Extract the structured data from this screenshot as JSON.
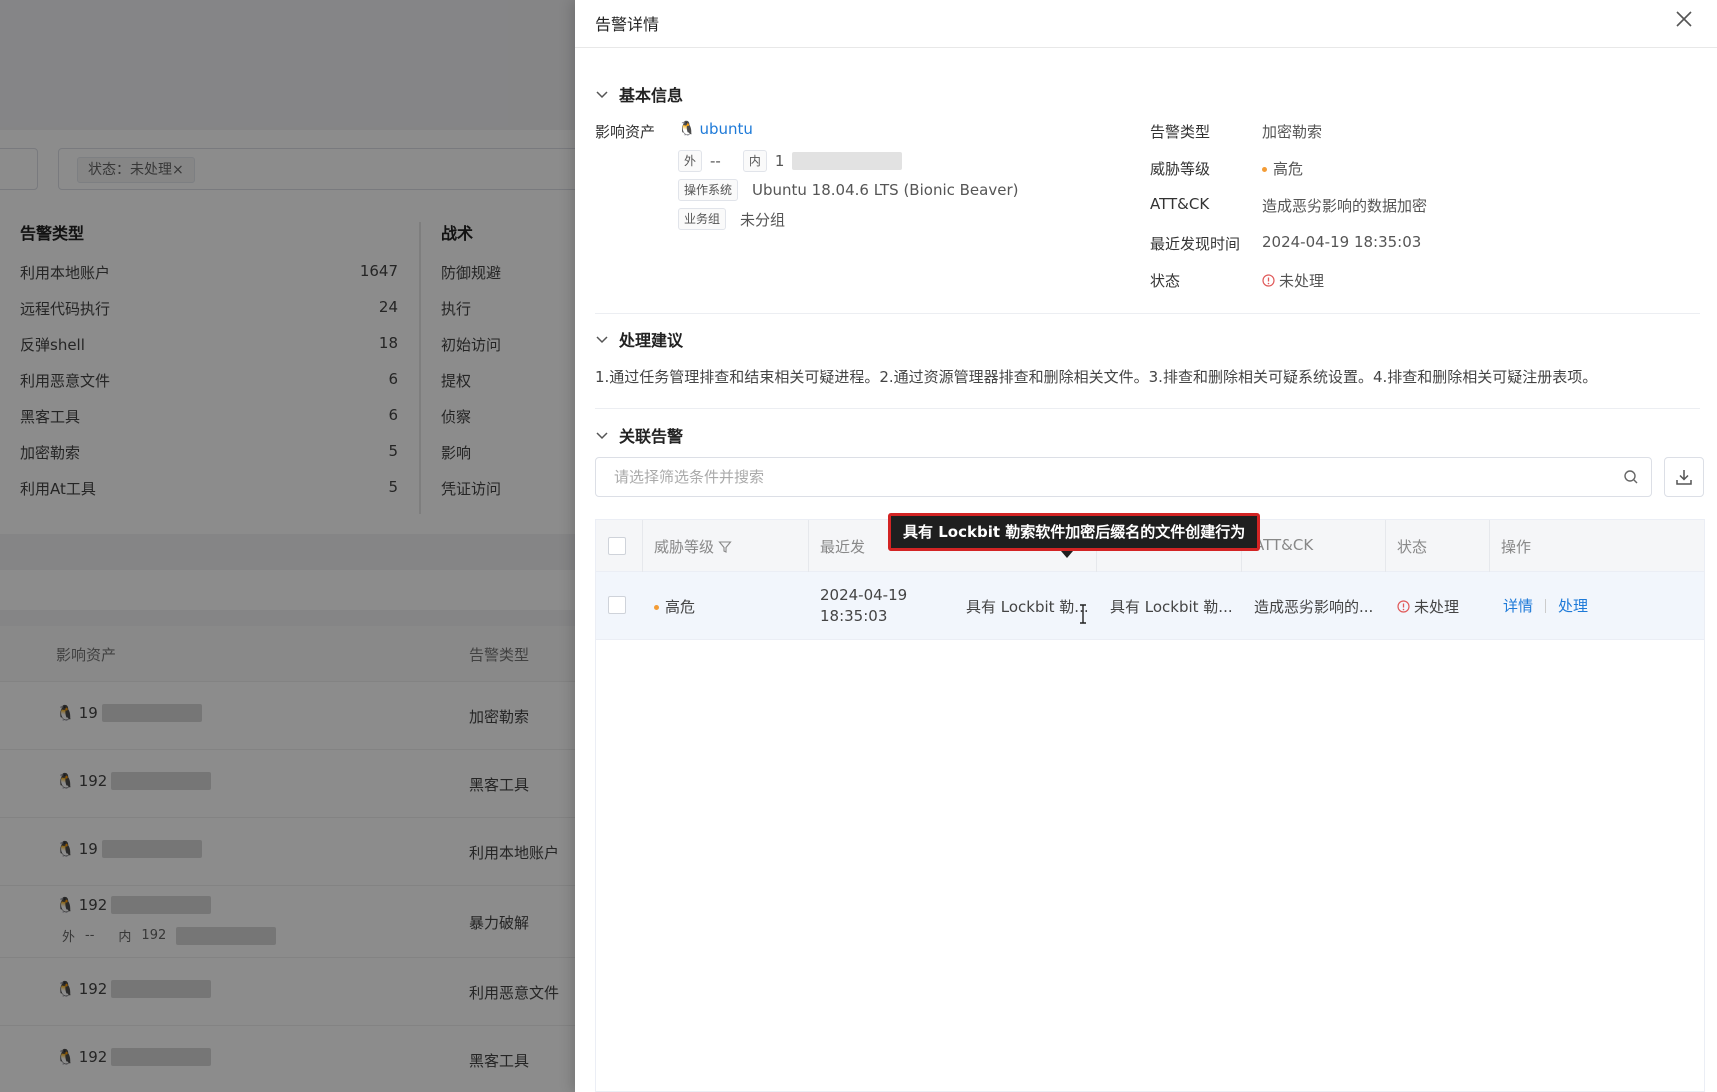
{
  "background": {
    "filter_chip": "状态：未处理×",
    "stats_title": "告警类型",
    "tactics_title": "战术",
    "stats": [
      {
        "name": "利用本地账户",
        "count": "1647"
      },
      {
        "name": "远程代码执行",
        "count": "24"
      },
      {
        "name": "反弹shell",
        "count": "18"
      },
      {
        "name": "利用恶意文件",
        "count": "6"
      },
      {
        "name": "黑客工具",
        "count": "6"
      },
      {
        "name": "加密勒索",
        "count": "5"
      },
      {
        "name": "利用At工具",
        "count": "5"
      }
    ],
    "tactics": [
      "防御规避",
      "执行",
      "初始访问",
      "提权",
      "侦察",
      "影响",
      "凭证访问"
    ],
    "table_headers": {
      "asset": "影响资产",
      "type": "告警类型"
    },
    "rows": [
      {
        "ip": "19",
        "type": "加密勒索"
      },
      {
        "ip": "192",
        "type": "黑客工具"
      },
      {
        "ip": "19",
        "type": "利用本地账户"
      },
      {
        "ip": "192",
        "type": "暴力破解",
        "ext_label": "外",
        "ext_value": "--",
        "int_label": "内",
        "int_value": "192"
      },
      {
        "ip": "192",
        "type": "利用恶意文件"
      },
      {
        "ip": "192",
        "type": "黑客工具"
      }
    ]
  },
  "drawer": {
    "title": "告警详情",
    "basic": {
      "section_title": "基本信息",
      "asset_label": "影响资产",
      "asset_name": "ubuntu",
      "ext_tag": "外",
      "ext_value": "--",
      "int_tag": "内",
      "int_value": "1",
      "os_tag": "操作系统",
      "os_value": "Ubuntu 18.04.6 LTS (Bionic Beaver)",
      "group_tag": "业务组",
      "group_value": "未分组",
      "alert_type_label": "告警类型",
      "alert_type_value": "加密勒索",
      "threat_label": "威胁等级",
      "threat_value": "高危",
      "attck_label": "ATT&CK",
      "attck_value": "造成恶劣影响的数据加密",
      "recent_label": "最近发现时间",
      "recent_value": "2024-04-19 18:35:03",
      "status_label": "状态",
      "status_value": "未处理"
    },
    "advice": {
      "section_title": "处理建议",
      "text": "1.通过任务管理排查和结束相关可疑进程。2.通过资源管理器排查和删除相关文件。3.排查和删除相关可疑系统设置。4.排查和删除相关可疑注册表项。"
    },
    "related": {
      "section_title": "关联告警",
      "search_placeholder": "请选择筛选条件并搜索",
      "headers": {
        "threat": "威胁等级",
        "recent": "最近发",
        "attck": "ATT&CK",
        "status": "状态",
        "action": "操作"
      },
      "rows": [
        {
          "threat": "高危",
          "date": "2024-04-19",
          "time": "18:35:03",
          "col3": "具有 Lockbit 勒...",
          "col4": "具有 Lockbit 勒...",
          "attck": "造成恶劣影响的...",
          "status": "未处理",
          "action_detail": "详情",
          "action_handle": "处理"
        }
      ],
      "tooltip": "具有 Lockbit 勒索软件加密后缀名的文件创建行为"
    }
  },
  "colors": {
    "link": "#1e7ad8",
    "high_risk_dot": "#f39c36",
    "status_red": "#e05a5a",
    "tooltip_border": "#d32424"
  }
}
